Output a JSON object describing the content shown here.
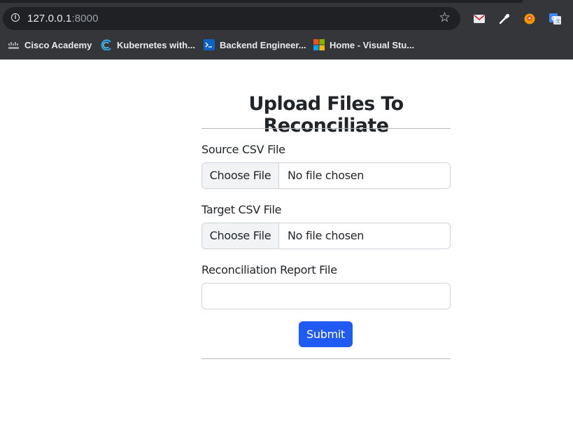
{
  "browser": {
    "url_host": "127.0.0.1",
    "url_port": ":8000",
    "bookmarks": [
      {
        "label": "Cisco Academy",
        "icon": "cisco-icon"
      },
      {
        "label": "Kubernetes with...",
        "icon": "kubernetes-swirl-icon"
      },
      {
        "label": "Backend Engineer...",
        "icon": "terminal-icon"
      },
      {
        "label": "Home - Visual Stu...",
        "icon": "microsoft-logo-icon"
      }
    ],
    "extensions": [
      "mail-extension-icon",
      "eyedropper-extension-icon",
      "location-extension-icon",
      "translate-extension-icon"
    ]
  },
  "form": {
    "title": "Upload Files To Reconciliate",
    "source": {
      "label": "Source CSV File",
      "button": "Choose File",
      "status": "No file chosen"
    },
    "target": {
      "label": "Target CSV File",
      "button": "Choose File",
      "status": "No file chosen"
    },
    "report": {
      "label": "Reconciliation Report File",
      "value": ""
    },
    "submit": "Submit"
  },
  "colors": {
    "accent": "#1f5bf2",
    "chrome_bg": "#35363a",
    "omnibox_bg": "#202124"
  }
}
